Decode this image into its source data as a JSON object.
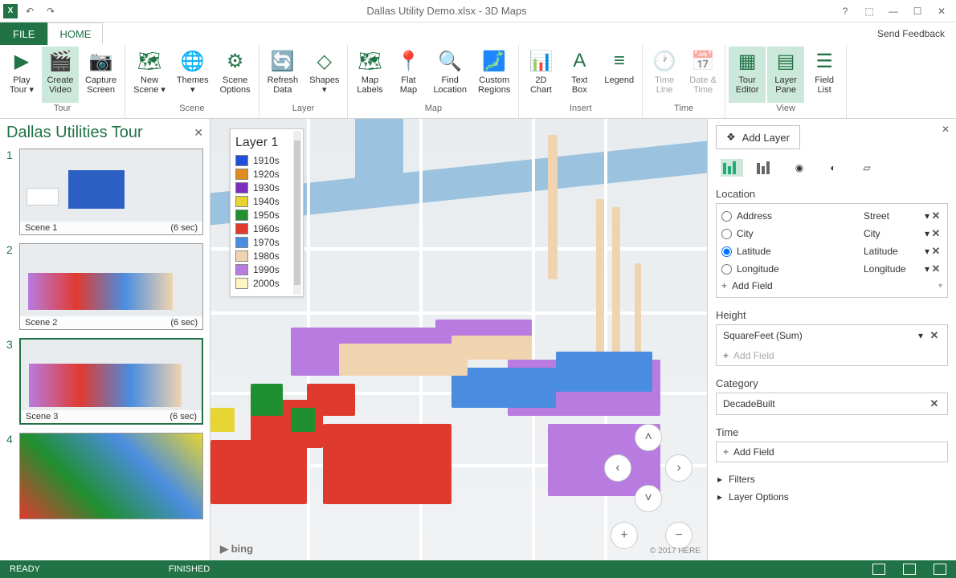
{
  "titlebar": {
    "title": "Dallas Utility Demo.xlsx - 3D Maps"
  },
  "tabs": {
    "file": "FILE",
    "home": "HOME",
    "feedback": "Send Feedback"
  },
  "ribbon": {
    "groups": [
      {
        "label": "Tour",
        "items": [
          {
            "name": "play-tour",
            "label": "Play\nTour ▾",
            "icon": "▶"
          },
          {
            "name": "create-video",
            "label": "Create\nVideo",
            "icon": "🎬",
            "active": true
          },
          {
            "name": "capture-screen",
            "label": "Capture\nScreen",
            "icon": "📷"
          }
        ]
      },
      {
        "label": "Scene",
        "items": [
          {
            "name": "new-scene",
            "label": "New\nScene ▾",
            "icon": "🗺"
          },
          {
            "name": "themes",
            "label": "Themes\n▾",
            "icon": "🌐"
          },
          {
            "name": "scene-options",
            "label": "Scene\nOptions",
            "icon": "⚙"
          }
        ]
      },
      {
        "label": "Layer",
        "items": [
          {
            "name": "refresh-data",
            "label": "Refresh\nData",
            "icon": "🔄"
          },
          {
            "name": "shapes",
            "label": "Shapes\n▾",
            "icon": "◇"
          }
        ]
      },
      {
        "label": "Map",
        "items": [
          {
            "name": "map-labels",
            "label": "Map\nLabels",
            "icon": "🗺"
          },
          {
            "name": "flat-map",
            "label": "Flat\nMap",
            "icon": "📍"
          },
          {
            "name": "find-location",
            "label": "Find\nLocation",
            "icon": "🔍"
          },
          {
            "name": "custom-regions",
            "label": "Custom\nRegions",
            "icon": "🗾"
          }
        ]
      },
      {
        "label": "Insert",
        "items": [
          {
            "name": "2d-chart",
            "label": "2D\nChart",
            "icon": "📊"
          },
          {
            "name": "text-box",
            "label": "Text\nBox",
            "icon": "A"
          },
          {
            "name": "legend",
            "label": "Legend",
            "icon": "≡"
          }
        ]
      },
      {
        "label": "Time",
        "items": [
          {
            "name": "time-line",
            "label": "Time\nLine",
            "icon": "🕐",
            "disabled": true
          },
          {
            "name": "date-time",
            "label": "Date &\nTime",
            "icon": "📅",
            "disabled": true
          }
        ]
      },
      {
        "label": "View",
        "items": [
          {
            "name": "tour-editor",
            "label": "Tour\nEditor",
            "icon": "▦",
            "active": true
          },
          {
            "name": "layer-pane",
            "label": "Layer\nPane",
            "icon": "▤",
            "active": true
          },
          {
            "name": "field-list",
            "label": "Field\nList",
            "icon": "☰"
          }
        ]
      }
    ]
  },
  "tours": {
    "title": "Dallas Utilities Tour",
    "scenes": [
      {
        "num": "1",
        "name": "Scene 1",
        "dur": "(6 sec)"
      },
      {
        "num": "2",
        "name": "Scene 2",
        "dur": "(6 sec)"
      },
      {
        "num": "3",
        "name": "Scene 3",
        "dur": "(6 sec)",
        "selected": true
      },
      {
        "num": "4",
        "name": "",
        "dur": ""
      }
    ]
  },
  "legend": {
    "title": "Layer 1",
    "items": [
      {
        "c": "#1f4fd8",
        "t": "1910s"
      },
      {
        "c": "#e08c1f",
        "t": "1920s"
      },
      {
        "c": "#7b2fbf",
        "t": "1930s"
      },
      {
        "c": "#e6d533",
        "t": "1940s"
      },
      {
        "c": "#1f8f2f",
        "t": "1950s"
      },
      {
        "c": "#e03a2f",
        "t": "1960s"
      },
      {
        "c": "#4a8de0",
        "t": "1970s"
      },
      {
        "c": "#f0d4b0",
        "t": "1980s"
      },
      {
        "c": "#b87be0",
        "t": "1990s"
      },
      {
        "c": "#fff5c0",
        "t": "2000s"
      }
    ]
  },
  "map": {
    "attrib": "bing",
    "copyright": "© 2017 HERE"
  },
  "layerpane": {
    "addLayer": "Add Layer",
    "locationLabel": "Location",
    "location": [
      {
        "radio": false,
        "field": "Address",
        "map": "Street"
      },
      {
        "radio": false,
        "field": "City",
        "map": "City"
      },
      {
        "radio": true,
        "field": "Latitude",
        "map": "Latitude"
      },
      {
        "radio": false,
        "field": "Longitude",
        "map": "Longitude"
      }
    ],
    "addField": "Add Field",
    "heightLabel": "Height",
    "heightField": "SquareFeet (Sum)",
    "categoryLabel": "Category",
    "categoryField": "DecadeBuilt",
    "timeLabel": "Time",
    "filters": "Filters",
    "layerOptions": "Layer Options"
  },
  "status": {
    "ready": "READY",
    "finished": "FINISHED"
  }
}
